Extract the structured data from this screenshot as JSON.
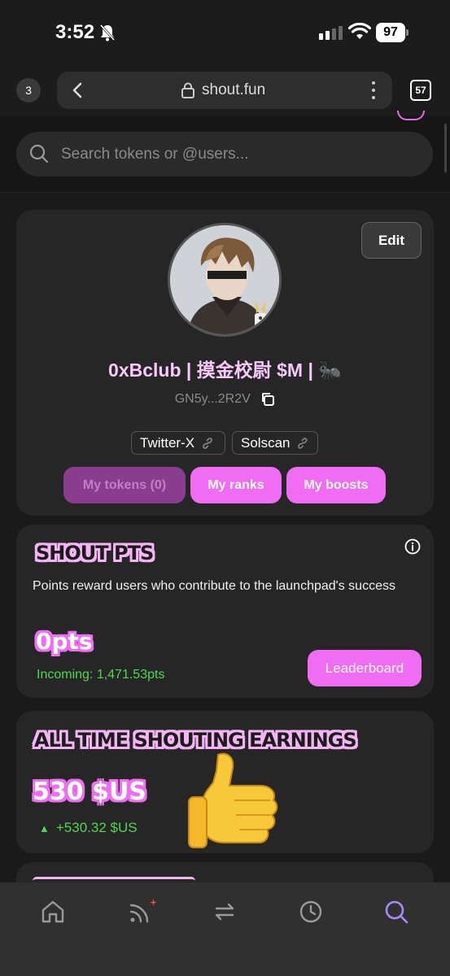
{
  "status_bar": {
    "time": "3:52",
    "battery": "97"
  },
  "browser": {
    "open_tabs_left": "3",
    "url": "shout.fun",
    "tab_count": "57"
  },
  "search": {
    "placeholder": "Search tokens or @users..."
  },
  "profile": {
    "edit_label": "Edit",
    "display_name": "0xBclub | 摸金校尉 $M | 🐜",
    "wallet_short": "GN5y...2R2V",
    "links": [
      "Twitter-X",
      "Solscan"
    ],
    "tabs": [
      "My tokens (0)",
      "My ranks",
      "My boosts"
    ]
  },
  "shout_pts": {
    "title": "SHOUT PTS",
    "description": "Points reward users who contribute to the launchpad's success",
    "value": "0pts",
    "incoming": "Incoming: 1,471.53pts",
    "leaderboard_label": "Leaderboard"
  },
  "earnings": {
    "title": "ALL TIME SHOUTING EARNINGS",
    "value": "530 $US",
    "change": "+530.32 $US"
  },
  "nav": {
    "items": [
      "home-icon",
      "feed-icon",
      "trade-icon",
      "history-icon",
      "search-icon"
    ],
    "active": "search-icon"
  },
  "colors": {
    "accent_pink": "#f06cf3",
    "positive_green": "#4fd84f",
    "active_nav": "#a78bfa"
  }
}
